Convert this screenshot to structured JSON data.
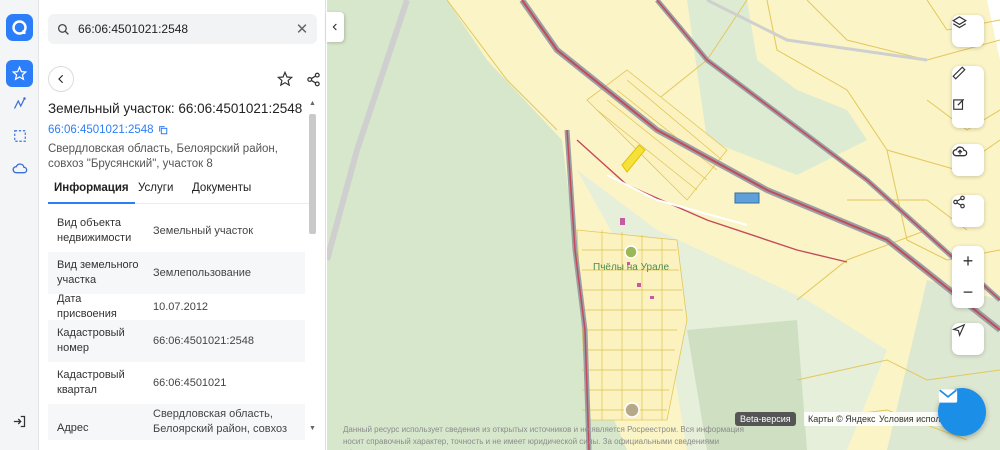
{
  "search": {
    "value": "66:06:4501021:2548"
  },
  "parcel": {
    "title": "Земельный участок: 66:06:4501021:2548",
    "cad_number": "66:06:4501021:2548",
    "address": "Свердловская область, Белоярский район, совхоз \"Брусянский\", участок 8"
  },
  "tabs": [
    {
      "label": "Информация"
    },
    {
      "label": "Услуги"
    },
    {
      "label": "Документы"
    }
  ],
  "info_rows": [
    {
      "key": "Вид объекта недвижимости",
      "value": "Земельный участок"
    },
    {
      "key": "Вид земельного участка",
      "value": "Землепользование"
    },
    {
      "key": "Дата присвоения",
      "value": "10.07.2012"
    },
    {
      "key": "Кадастровый номер",
      "value": "66:06:4501021:2548"
    },
    {
      "key": "Кадастровый квартал",
      "value": "66:06:4501021"
    },
    {
      "key": "Адрес",
      "value": "Свердловская область, Белоярский район, совхоз"
    }
  ],
  "map": {
    "place_label": "Пчёлы на Урале",
    "disclaimer": "Данный ресурс использует сведения из открытых источников и не является Росреестром. Вся информация носит справочный характер, точность и не имеет юридической силы. За официальными сведениями обращайтесь в Росреестр.",
    "beta": "Beta-версия",
    "yandex": "Карты © Яндекс",
    "terms": "Условия использования",
    "zoom_in": "+",
    "zoom_out": "−"
  },
  "colors": {
    "accent": "#2c7ef8",
    "map_base": "#fbf4c6",
    "forest": "#dcebd2",
    "parcel_line": "#e3c75a",
    "road": "#c44a5a",
    "fab": "#1b8ee8"
  },
  "icons": {
    "logo": "app-logo-icon",
    "favorites": "star-icon",
    "route": "route-icon",
    "select": "select-area-icon",
    "cloud": "cloud-icon",
    "login": "login-icon"
  }
}
